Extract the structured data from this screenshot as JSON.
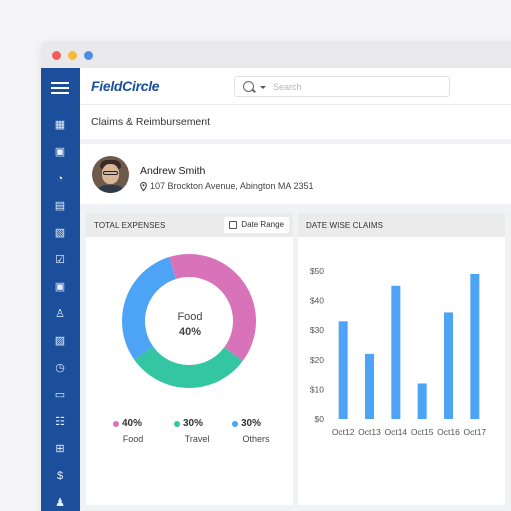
{
  "app": {
    "brand": "FieldCircle"
  },
  "search": {
    "placeholder": "Search"
  },
  "page": {
    "title": "Claims & Reimbursement"
  },
  "profile": {
    "name": "Andrew Smith",
    "address": "107 Brockton Avenue, Abington MA 2351"
  },
  "sidebar": {
    "icons": [
      "menu-icon",
      "dashboard-icon",
      "calendar-icon",
      "history-icon",
      "clipboard-icon",
      "document-settings-icon",
      "checkbox-icon",
      "calendar-add-icon",
      "user-add-icon",
      "invoice-icon",
      "clock-icon",
      "inbox-icon",
      "checklist-icon",
      "hierarchy-icon",
      "dollar-icon",
      "users-icon"
    ]
  },
  "expenses_card": {
    "title": "TOTAL EXPENSES",
    "date_range_label": "Date Range",
    "center_label": "Food",
    "center_value": "40%",
    "legend": [
      {
        "value": "40%",
        "name": "Food",
        "color": "#d873b9"
      },
      {
        "value": "30%",
        "name": "Travel",
        "color": "#34c6a3"
      },
      {
        "value": "30%",
        "name": "Others",
        "color": "#4da3f5"
      }
    ]
  },
  "claims_card": {
    "title": "DATE WISE CLAIMS"
  },
  "chart_data": [
    {
      "type": "pie",
      "title": "TOTAL EXPENSES",
      "categories": [
        "Food",
        "Travel",
        "Others"
      ],
      "values": [
        40,
        30,
        30
      ],
      "colors": [
        "#d873b9",
        "#34c6a3",
        "#4da3f5"
      ],
      "donut": true
    },
    {
      "type": "bar",
      "title": "DATE WISE CLAIMS",
      "categories": [
        "Oct12",
        "Oct13",
        "Oct14",
        "Oct15",
        "Oct16",
        "Oct17"
      ],
      "values": [
        33,
        22,
        45,
        12,
        36,
        49
      ],
      "yticks": [
        "$0",
        "$10",
        "$20",
        "$30",
        "$40",
        "$50"
      ],
      "ylim": [
        0,
        50
      ],
      "color": "#4da3f5",
      "grid": false
    }
  ]
}
